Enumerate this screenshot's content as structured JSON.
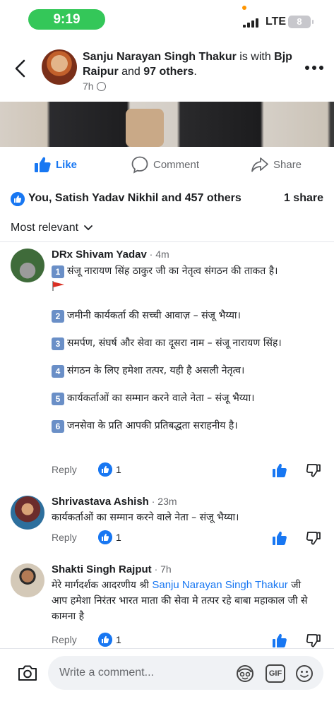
{
  "status_bar": {
    "time": "9:19",
    "network": "LTE",
    "battery": "8"
  },
  "post": {
    "author": "Sanju Narayan Singh Thakur",
    "with_text": " is with ",
    "tagged": "Bjp Raipur",
    "and_text": " and ",
    "others": "97 others",
    "period": ".",
    "time": "7h",
    "privacy_icon": "globe-icon"
  },
  "actions": {
    "like": "Like",
    "comment": "Comment",
    "share": "Share"
  },
  "reactions": {
    "summary": "You, Satish Yadav Nikhil and 457 others",
    "shares": "1 share"
  },
  "sort": {
    "label": "Most relevant"
  },
  "comments": [
    {
      "name": "DRx Shivam Yadav",
      "time": " · 4m",
      "lines": [
        {
          "num": "1",
          "text": "संजू नारायण सिंह ठाकुर जी का नेतृत्व संगठन की ताकत है।"
        },
        {
          "num": "2",
          "text": "जमीनी कार्यकर्ता की सच्ची आवाज़ – संजू भैय्या।"
        },
        {
          "num": "3",
          "text": "समर्पण, संघर्ष और सेवा का दूसरा नाम – संजू नारायण सिंह।"
        },
        {
          "num": "4",
          "text": "संगठन के लिए हमेशा तत्पर, यही है असली नेतृत्व।"
        },
        {
          "num": "5",
          "text": "कार्यकर्ताओं का सम्मान करने वाले नेता – संजू भैय्या।"
        },
        {
          "num": "6",
          "text": "जनसेवा के प्रति आपकी प्रतिबद्धता सराहनीय है।"
        }
      ],
      "reply": "Reply",
      "reaction_count": "1"
    },
    {
      "name": "Shrivastava Ashish",
      "time": " · 23m",
      "text": "कार्यकर्ताओं का सम्मान करने वाले नेता – संजू भैय्या।",
      "reply": "Reply",
      "reaction_count": "1"
    },
    {
      "name": "Shakti Singh Rajput",
      "time": " · 7h",
      "text_before": "मेरे मार्गदर्शक आदरणीय श्री ",
      "mention": "Sanju Narayan Singh Thakur",
      "text_after": " जी आप हमेशा निरंतर भारत माता की सेवा मे तत्पर रहे बाबा महाकाल जी से कामना है",
      "reply": "Reply",
      "reaction_count": "1"
    }
  ],
  "composer": {
    "placeholder": "Write a comment...",
    "gif": "GIF"
  },
  "colors": {
    "accent": "#1877f2",
    "status_green": "#34c759",
    "secondary_text": "#65676b"
  }
}
